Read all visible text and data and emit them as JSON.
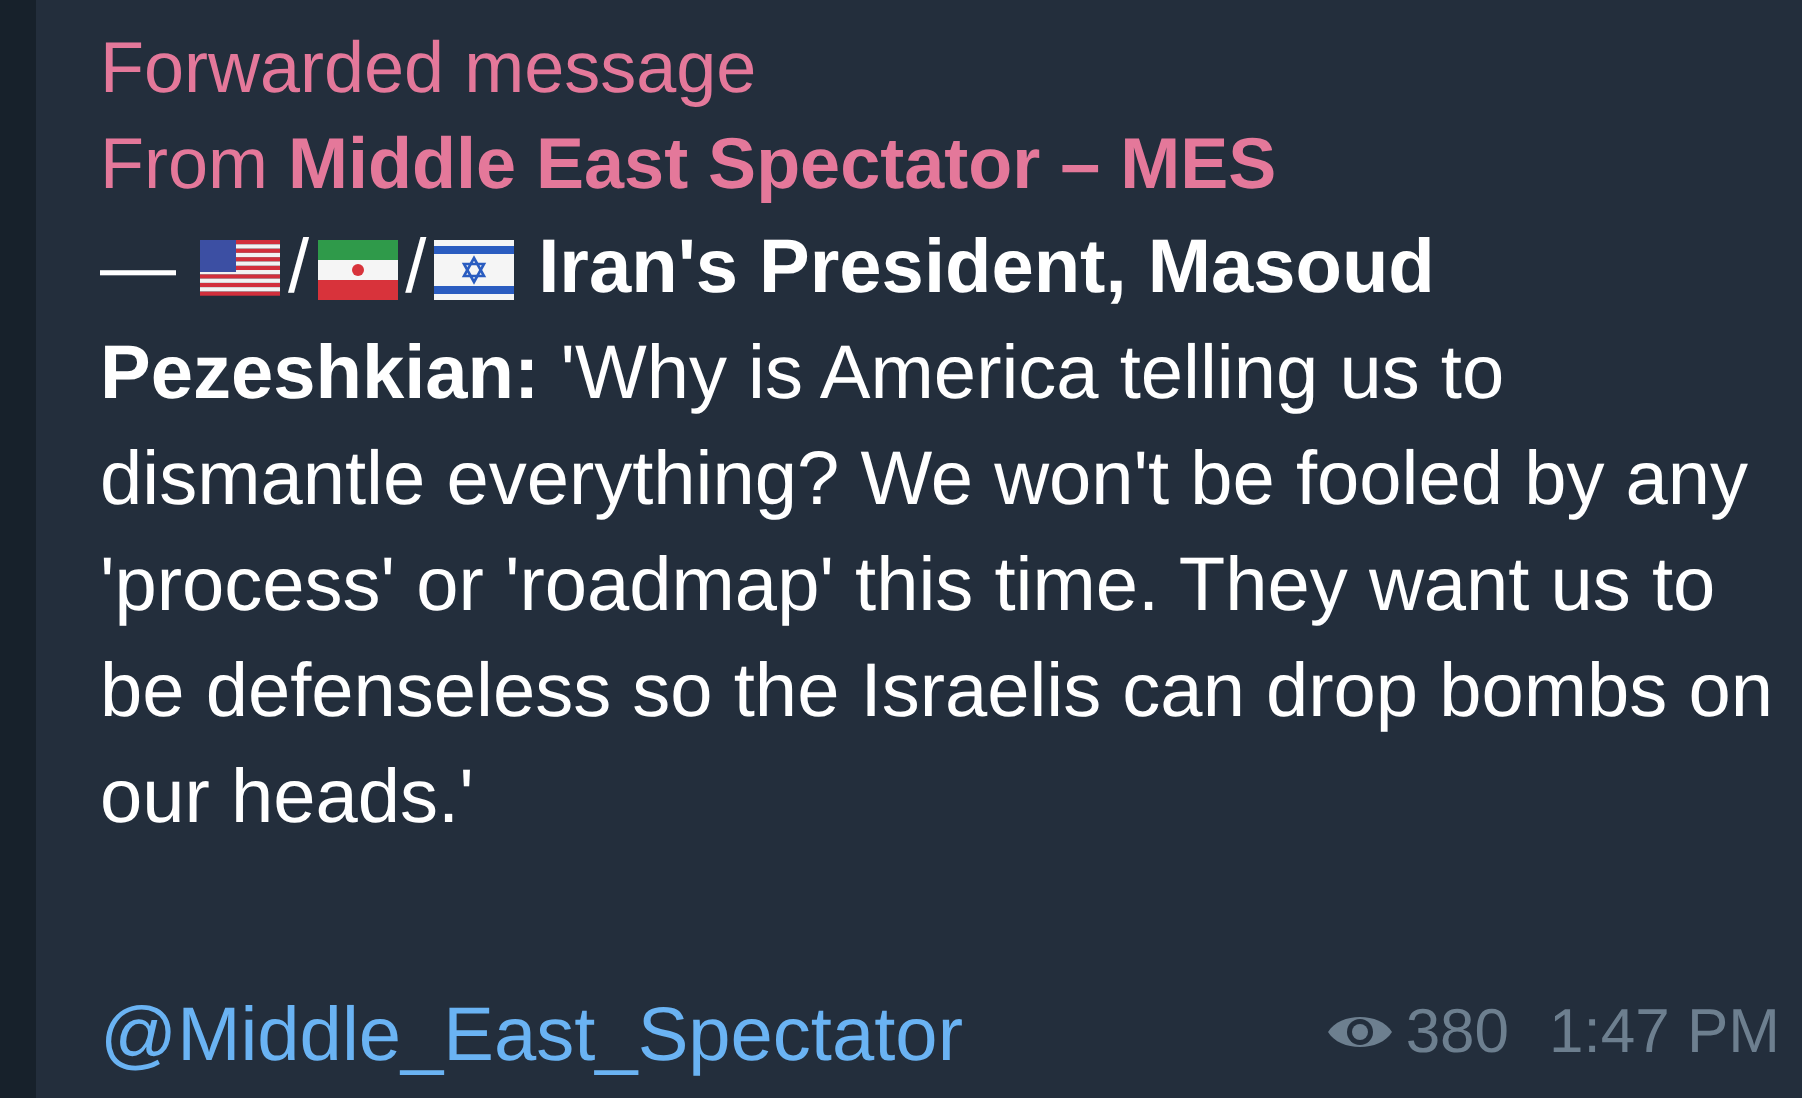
{
  "forward_header": {
    "label": "Forwarded message",
    "from_prefix": "From",
    "from_name": "Middle East Spectator – MES"
  },
  "message": {
    "dash": "—",
    "separators": [
      "/",
      "/"
    ],
    "title": "Iran's President, Masoud",
    "text": "**Pezeshkian:** 'Why is America telling us to dismantle everything? We won't be fooled by any 'process' or 'roadmap' this time. They want us to be defenseless so the Israelis can drop bombs on our heads.'",
    "link": "@Middle_East_Spectator"
  },
  "footer": {
    "views": "380",
    "time": "1:47 PM"
  }
}
